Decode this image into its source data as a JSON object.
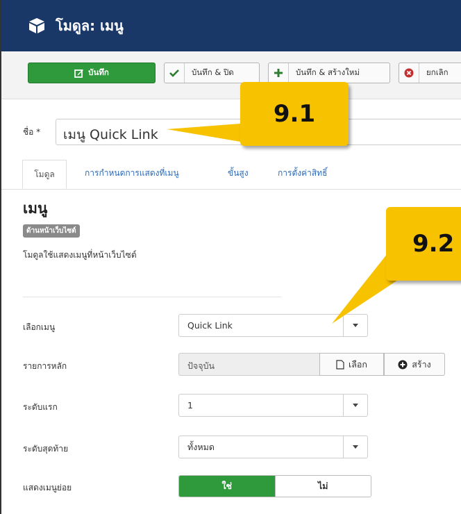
{
  "header": {
    "title": "โมดูล: เมนู",
    "bg": "#1a3867"
  },
  "toolbar": {
    "save_label": "บันทึก",
    "save_close_label": "บันทึก & ปิด",
    "save_new_label": "บันทึก & สร้างใหม่",
    "cancel_label": "ยกเลิก"
  },
  "form": {
    "name_label": "ชื่อ *",
    "name_value": "เมนู Quick Link"
  },
  "tabs": [
    {
      "label": "โมดูล",
      "active": true
    },
    {
      "label": "การกำหนดการแสดงที่เมนู"
    },
    {
      "label": "ขั้นสูง"
    },
    {
      "label": "การตั้งค่าสิทธิ์"
    }
  ],
  "module": {
    "title": "เมนู",
    "badge": "ด้านหน้าเว็บไซต์",
    "description": "โมดูลใช้แสดงเมนูที่หน้าเว็บไซต์"
  },
  "fields": {
    "select_menu": {
      "label": "เลือกเมนู",
      "value": "Quick Link"
    },
    "base_item": {
      "label": "รายการหลัก",
      "value": "ปัจจุบัน",
      "select_label": "เลือก",
      "create_label": "สร้าง"
    },
    "start_level": {
      "label": "ระดับแรก",
      "value": "1"
    },
    "end_level": {
      "label": "ระดับสุดท้าย",
      "value": "ทั้งหมด"
    },
    "show_submenu": {
      "label": "แสดงเมนูย่อย",
      "yes": "ใช่",
      "no": "ไม่"
    }
  },
  "callouts": {
    "first": "9.1",
    "second": "9.2"
  },
  "colors": {
    "accent_green": "#2f9a3b",
    "callout": "#f7c200"
  }
}
